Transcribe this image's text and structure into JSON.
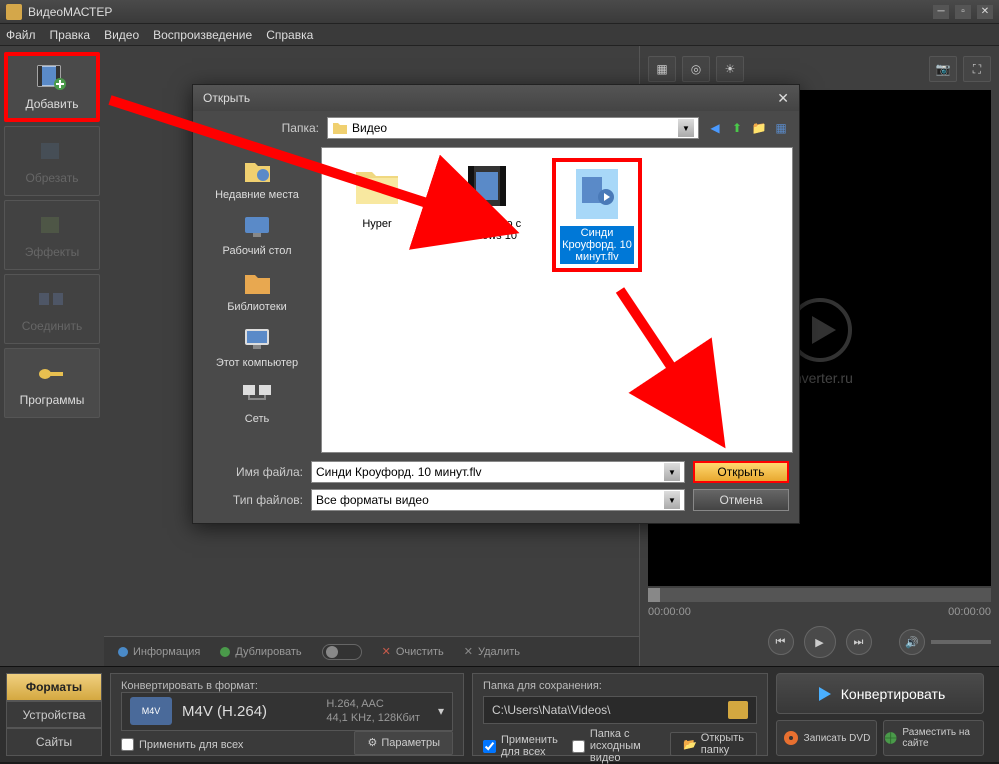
{
  "app": {
    "title": "ВидеоМАСТЕР"
  },
  "menu": {
    "file": "Файл",
    "edit": "Правка",
    "video": "Видео",
    "play": "Воспроизведение",
    "help": "Справка"
  },
  "sidebar": {
    "add": "Добавить",
    "crop": "Обрезать",
    "effects": "Эффекты",
    "join": "Соединить",
    "programs": "Программы"
  },
  "actions": {
    "info": "Информация",
    "duplicate": "Дублировать",
    "clear": "Очистить",
    "delete": "Удалить"
  },
  "preview": {
    "watermark": "onverter.ru",
    "time_start": "00:00:00",
    "time_end": "00:00:00"
  },
  "dialog": {
    "title": "Открыть",
    "folder_label": "Папка:",
    "folder_value": "Видео",
    "places": {
      "recent": "Недавние места",
      "desktop": "Рабочий стол",
      "libraries": "Библиотеки",
      "computer": "Этот компьютер",
      "network": "Сеть"
    },
    "files": {
      "f1": "Hyper",
      "f2": "Знакомство с Windows 10",
      "f3": "Синди Кроуфорд. 10 минут.flv"
    },
    "filename_label": "Имя файла:",
    "filename_value": "Синди Кроуфорд. 10 минут.flv",
    "filetype_label": "Тип файлов:",
    "filetype_value": "Все форматы видео",
    "open_btn": "Открыть",
    "cancel_btn": "Отмена"
  },
  "bottom": {
    "tabs": {
      "formats": "Форматы",
      "devices": "Устройства",
      "sites": "Сайты"
    },
    "convert_to_label": "Конвертировать в формат:",
    "format_badge": "M4V",
    "format_name": "M4V (H.264)",
    "format_line1": "H.264, AAC",
    "format_line2": "44,1 KHz, 128Кбит",
    "apply_all": "Применить для всех",
    "params": "Параметры",
    "save_folder_label": "Папка для сохранения:",
    "save_folder_path": "C:\\Users\\Nata\\Videos\\",
    "source_folder": "Папка с исходным видео",
    "open_folder": "Открыть папку",
    "convert": "Конвертировать",
    "burn_dvd": "Записать DVD",
    "publish": "Разместить на сайте"
  }
}
